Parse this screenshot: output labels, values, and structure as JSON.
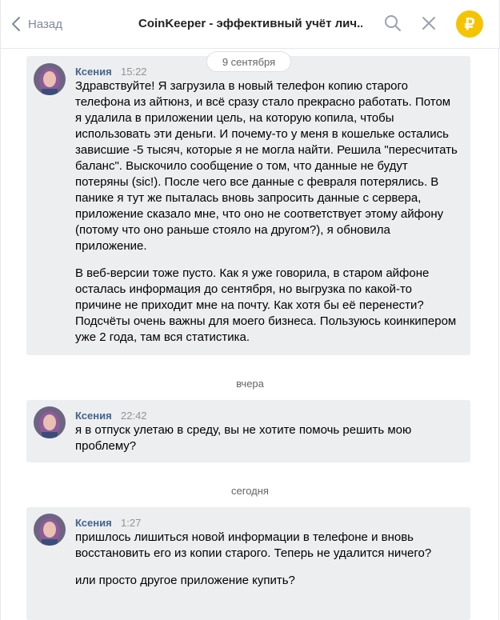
{
  "header": {
    "back_label": "Назад",
    "title": "CoinKeeper - эффективный учёт лич...",
    "logo_symbol": "₽",
    "accent": "#f5c400"
  },
  "dates": {
    "first": "9 сентября",
    "yesterday": "вчера",
    "today": "сегодня"
  },
  "messages": [
    {
      "author": "Ксения",
      "time": "15:22",
      "paragraphs": [
        "Здравствуйте! Я загрузила в новый телефон копию старого телефона из айтюнз, и всё сразу стало прекрасно работать. Потом я удалила в приложении цель, на которую копила, чтобы использовать эти деньги. И почему-то у меня в кошельке остались зависшие -5 тысяч, которые я не могла найти. Решила \"пересчитать баланс\". Выскочило сообщение о том, что данные не будут потеряны (sic!). После чего все данные с февраля потерялись. В панике я тут же пыталась вновь запросить данные с сервера, приложение сказало мне, что оно не соответствует этому айфону (потому что оно раньше стояло на другом?), я обновила приложение.",
        "В веб-версии тоже пусто. Как я уже говорила, в старом айфоне осталась информация до сентября, но выгрузка по какой-то причине не приходит мне на почту. Как хотя бы её перенести? Подсчёты очень важны для моего бизнеса. Пользуюсь коинкипером уже 2 года, там вся статистика."
      ]
    },
    {
      "author": "Ксения",
      "time": "22:42",
      "paragraphs": [
        "я в отпуск улетаю в среду, вы не хотите помочь решить мою проблему?"
      ]
    },
    {
      "author": "Ксения",
      "time": "1:27",
      "paragraphs": [
        "пришлось лишиться новой информации в телефоне и вновь восстановить его из копии старого. Теперь не удалится ничего?",
        "или просто другое приложение купить?"
      ]
    }
  ]
}
